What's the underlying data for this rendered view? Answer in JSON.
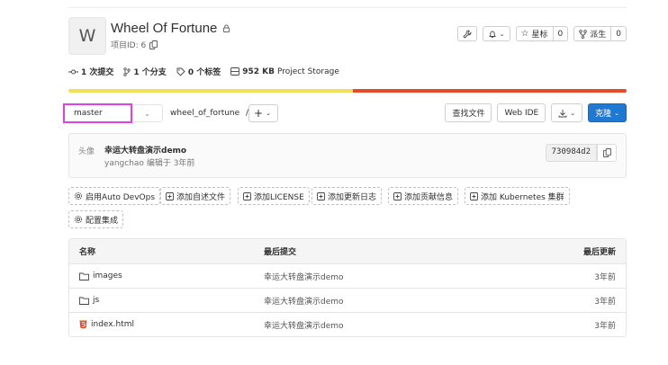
{
  "project": {
    "avatar_letter": "W",
    "name": "Wheel Of Fortune",
    "id_label": "项目ID: 6",
    "icons": [
      "lock-icon",
      "copy-icon"
    ]
  },
  "header_actions": {
    "settings_icon": "wrench-icon",
    "notification_icon": "bell-icon",
    "star_label": "星标",
    "star_count": "0",
    "fork_label": "派生",
    "fork_count": "0"
  },
  "stats": {
    "commits": "1 次提交",
    "branches": "1 个分支",
    "tags": "0 个标签",
    "storage_value": "952 KB",
    "storage_label": "Project Storage"
  },
  "language_bar": {
    "segments": [
      {
        "color": "#f1e05a",
        "fraction": 0.51
      },
      {
        "color": "#e34c26",
        "fraction": 0.49
      }
    ]
  },
  "branch_row": {
    "branch": "master",
    "path": "wheel_of_fortune",
    "separator": "/",
    "find_file": "查找文件",
    "web_ide": "Web IDE",
    "clone": "克隆"
  },
  "last_commit": {
    "avatar_alt": "头像",
    "title": "幸运大转盘演示demo",
    "author": "yangchao",
    "action": "编辑于",
    "time": "3年前",
    "sha": "730984d2"
  },
  "suggestions": [
    {
      "icon": "gear-icon",
      "label": "启用Auto DevOps"
    },
    {
      "icon": "plus-square-icon",
      "label": "添加自述文件"
    },
    {
      "icon": "plus-square-icon",
      "label": "添加LICENSE"
    },
    {
      "icon": "plus-square-icon",
      "label": "添加更新日志"
    },
    {
      "icon": "plus-square-icon",
      "label": "添加贡献信息"
    },
    {
      "icon": "plus-square-icon",
      "label": "添加 Kubernetes 集群"
    },
    {
      "icon": "gear-icon",
      "label": "配置集成"
    }
  ],
  "files": {
    "headers": [
      "名称",
      "最后提交",
      "最后更新"
    ],
    "rows": [
      {
        "name": "images",
        "type": "folder",
        "commit": "幸运大转盘演示demo",
        "updated": "3年前"
      },
      {
        "name": "js",
        "type": "folder",
        "commit": "幸运大转盘演示demo",
        "updated": "3年前"
      },
      {
        "name": "index.html",
        "type": "html",
        "commit": "幸运大转盘演示demo",
        "updated": "3年前"
      }
    ]
  },
  "colors": {
    "primary": "#1f78d1",
    "branch_highlight": "#e040e0",
    "html_icon": "#e34c26"
  }
}
